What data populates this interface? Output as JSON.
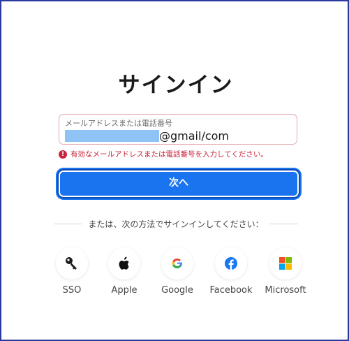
{
  "title": "サインイン",
  "field": {
    "label": "メールアドレスまたは電話番号",
    "value_suffix": "@gmail/com"
  },
  "error": {
    "icon": "!",
    "text": "有効なメールアドレスまたは電話番号を入力してください。"
  },
  "next_button": "次へ",
  "divider_text": "または、次の方法でサインインしてください：",
  "providers": [
    {
      "label": "SSO",
      "icon": "key-icon"
    },
    {
      "label": "Apple",
      "icon": "apple-icon"
    },
    {
      "label": "Google",
      "icon": "google-icon"
    },
    {
      "label": "Facebook",
      "icon": "facebook-icon"
    },
    {
      "label": "Microsoft",
      "icon": "microsoft-icon"
    }
  ],
  "colors": {
    "primary": "#1a74f0",
    "error": "#c8243c",
    "frame": "#2c3a9e",
    "redaction": "#8fc3f6"
  }
}
